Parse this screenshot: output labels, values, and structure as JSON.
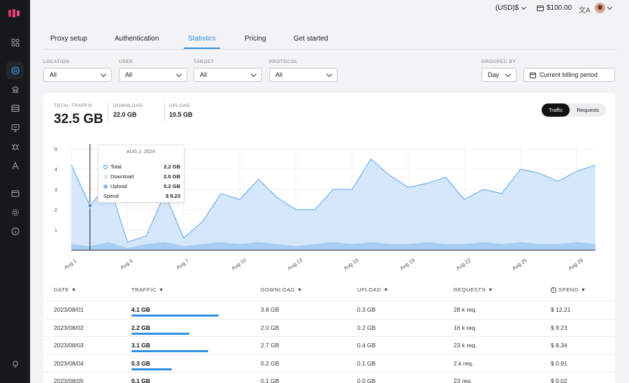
{
  "topbar": {
    "currency": "(USD)$",
    "balance": "$100.00",
    "lang_glyph": "文A"
  },
  "tabs": [
    "Proxy setup",
    "Authentication",
    "Statistics",
    "Pricing",
    "Get started"
  ],
  "active_tab": "Statistics",
  "filters": {
    "location": {
      "label": "LOCATION",
      "value": "All"
    },
    "user": {
      "label": "USER",
      "value": "All"
    },
    "target": {
      "label": "TARGET",
      "value": "All"
    },
    "protocol": {
      "label": "PROTOCOL",
      "value": "All"
    },
    "grouped_by": {
      "label": "GROUPED BY",
      "value": "Day"
    },
    "period": {
      "value": "Current billing period"
    }
  },
  "stats": {
    "total_label": "TOTAL TRAFFIC",
    "total_value": "32.5 GB",
    "download_label": "DOWNLOAD",
    "download_value": "22.0 GB",
    "upload_label": "UPLOAD",
    "upload_value": "10.5 GB"
  },
  "toggle": {
    "traffic": "Traffic",
    "requests": "Requests"
  },
  "tooltip": {
    "date": "AUG 2, 2024",
    "rows": [
      {
        "label": "Total",
        "value": "2.2 GB"
      },
      {
        "label": "Download",
        "value": "2.0 GB"
      },
      {
        "label": "Upload",
        "value": "0.2 GB"
      },
      {
        "label": "Spend",
        "value": "$ 9.23"
      }
    ]
  },
  "colors": {
    "accent": "#2f8fe0",
    "area_light": "#d4e7fb",
    "area_dark": "#a7cdf3",
    "line": "#5aa6ea"
  },
  "chart_data": {
    "type": "area",
    "y_ticks": [
      "1",
      "2",
      "3",
      "4",
      "5"
    ],
    "ylim": [
      0,
      5
    ],
    "x_tick_labels": [
      "Aug 1",
      "Aug 4",
      "Aug 7",
      "Aug 10",
      "Aug 13",
      "Aug 16",
      "Aug 19",
      "Aug 22",
      "Aug 25",
      "Aug 28"
    ],
    "x": [
      "Aug 1",
      "Aug 2",
      "Aug 3",
      "Aug 4",
      "Aug 5",
      "Aug 6",
      "Aug 7",
      "Aug 8",
      "Aug 9",
      "Aug 10",
      "Aug 11",
      "Aug 12",
      "Aug 13",
      "Aug 14",
      "Aug 15",
      "Aug 16",
      "Aug 17",
      "Aug 18",
      "Aug 19",
      "Aug 20",
      "Aug 21",
      "Aug 22",
      "Aug 23",
      "Aug 24",
      "Aug 25",
      "Aug 26",
      "Aug 27",
      "Aug 28",
      "Aug 29"
    ],
    "series": [
      {
        "name": "Total",
        "values": [
          4.2,
          2.2,
          3.3,
          0.4,
          0.7,
          2.8,
          0.6,
          1.4,
          2.8,
          2.5,
          3.5,
          2.6,
          2.0,
          2.0,
          3.0,
          3.0,
          4.5,
          3.7,
          3.1,
          3.3,
          3.6,
          2.5,
          3.0,
          2.8,
          4.0,
          3.8,
          3.4,
          3.9,
          4.2
        ]
      },
      {
        "name": "Upload",
        "values": [
          0.3,
          0.2,
          0.4,
          0.1,
          0.3,
          0.4,
          0.2,
          0.3,
          0.4,
          0.3,
          0.4,
          0.3,
          0.2,
          0.3,
          0.4,
          0.3,
          0.4,
          0.3,
          0.3,
          0.4,
          0.3,
          0.3,
          0.4,
          0.3,
          0.4,
          0.3,
          0.3,
          0.4,
          0.3
        ]
      }
    ]
  },
  "table": {
    "headers": [
      "DATE",
      "TRAFFIC",
      "DOWNLOAD",
      "UPLOAD",
      "REQUESTS",
      "SPEND"
    ],
    "rows": [
      {
        "date": "2023/08/01",
        "traffic": "4.1 GB",
        "fill": 1.0,
        "download": "3.8 GB",
        "upload": "0.3 GB",
        "requests": "28 k req.",
        "spend": "$ 12.21"
      },
      {
        "date": "2023/08/02",
        "traffic": "2.2 GB",
        "fill": 0.66,
        "download": "2.0 GB",
        "upload": "0.2 GB",
        "requests": "16 k req.",
        "spend": "$ 9.23"
      },
      {
        "date": "2023/08/03",
        "traffic": "3.1 GB",
        "fill": 0.88,
        "download": "2.7 GB",
        "upload": "0.4 GB",
        "requests": "23 k req.",
        "spend": "$ 8.34"
      },
      {
        "date": "2023/08/04",
        "traffic": "0.3 GB",
        "fill": 0.46,
        "download": "0.2 GB",
        "upload": "0.1 GB",
        "requests": "2 k req.",
        "spend": "$ 0.91"
      },
      {
        "date": "2023/08/05",
        "traffic": "0.1 GB",
        "fill": 0.3,
        "download": "0.1 GB",
        "upload": "0.0 GB",
        "requests": "23 req.",
        "spend": "$ 0.02"
      }
    ]
  }
}
